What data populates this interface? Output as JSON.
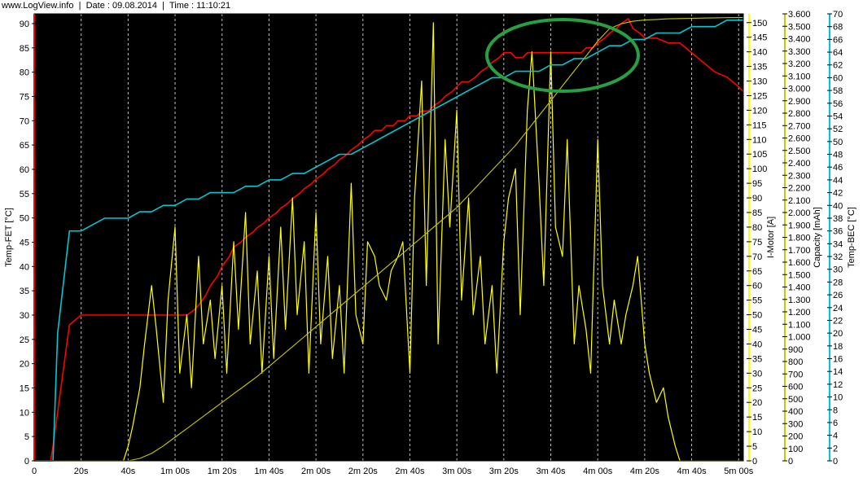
{
  "header": {
    "site": "www.LogView.info",
    "sep": "|",
    "date_label": "Date : 09.08.2014",
    "time_label": "Time : 11:10:21"
  },
  "colors": {
    "plot_bg": "#000000",
    "temp_fet": "#ff0000",
    "i_motor": "#ffff00",
    "capacity": "#c8c800",
    "temp_bec": "#00c8d2",
    "highlight_ellipse": "#28a040"
  },
  "chart_data": {
    "type": "line",
    "x_ticks": [
      "0",
      "20s",
      "40s",
      "1m 00s",
      "1m 20s",
      "1m 40s",
      "2m 00s",
      "2m 20s",
      "2m 40s",
      "3m 00s",
      "3m 20s",
      "3m 40s",
      "4m 00s",
      "4m 20s",
      "4m 40s",
      "5m 00s"
    ],
    "xlim_s": [
      0,
      302
    ],
    "grid": "vertical dashed at each x tick",
    "axes": {
      "temp_fet": {
        "label": "Temp-FET [°C]",
        "ylim": [
          0,
          92
        ],
        "ticks": [
          0,
          5,
          10,
          15,
          20,
          25,
          30,
          35,
          40,
          45,
          50,
          55,
          60,
          65,
          70,
          75,
          80,
          85,
          90
        ]
      },
      "i_motor": {
        "label": "I-Motor [A]",
        "ylim": [
          0,
          153
        ],
        "ticks": [
          0,
          5,
          10,
          15,
          20,
          25,
          30,
          35,
          40,
          45,
          50,
          55,
          60,
          65,
          70,
          75,
          80,
          85,
          90,
          95,
          100,
          105,
          110,
          115,
          120,
          125,
          130,
          135,
          140,
          145,
          150
        ]
      },
      "capacity": {
        "label": "Capacity [mAh]",
        "ylim": [
          0,
          3600
        ],
        "ticks": [
          "0",
          "100",
          "200",
          "300",
          "400",
          "500",
          "600",
          "700",
          "800",
          "900",
          "1.000",
          "1.100",
          "1.200",
          "1.300",
          "1.400",
          "1.500",
          "1.600",
          "1.700",
          "1.800",
          "1.900",
          "2.000",
          "2.100",
          "2.200",
          "2.300",
          "2.400",
          "2.500",
          "2.600",
          "2.700",
          "2.800",
          "2.900",
          "3.000",
          "3.100",
          "3.200",
          "3.300",
          "3.400",
          "3.500",
          "3.600"
        ]
      },
      "temp_bec": {
        "label": "Temp-BEC [°C]",
        "ylim": [
          0,
          70
        ],
        "ticks": [
          0,
          2,
          4,
          6,
          8,
          10,
          12,
          14,
          16,
          18,
          20,
          22,
          24,
          26,
          28,
          30,
          32,
          34,
          36,
          38,
          40,
          42,
          44,
          46,
          48,
          50,
          52,
          54,
          56,
          58,
          60,
          62,
          64,
          66,
          68,
          70
        ]
      }
    },
    "series": [
      {
        "axis": "temp_fet",
        "key": "temp_fet",
        "x": [
          0,
          7,
          8,
          15,
          20,
          30,
          35,
          40,
          45,
          48,
          50,
          53,
          55,
          58,
          60,
          63,
          65,
          68,
          70,
          73,
          75,
          78,
          80,
          83,
          85,
          88,
          90,
          93,
          95,
          98,
          100,
          103,
          105,
          108,
          110,
          113,
          115,
          118,
          120,
          123,
          125,
          128,
          130,
          133,
          135,
          138,
          140,
          143,
          145,
          148,
          150,
          153,
          155,
          158,
          160,
          163,
          165,
          168,
          170,
          173,
          175,
          178,
          180,
          182,
          185,
          188,
          190,
          193,
          195,
          198,
          200,
          203,
          205,
          208,
          210,
          213,
          215,
          218,
          220,
          223,
          225,
          228,
          230,
          233,
          235,
          238,
          240,
          243,
          245,
          248,
          250,
          253,
          255,
          258,
          260,
          265,
          270,
          275,
          280,
          285,
          290,
          295,
          300,
          302
        ],
        "y": [
          0,
          0,
          3,
          28,
          30,
          30,
          30,
          30,
          30,
          30,
          30,
          30,
          30,
          30,
          30,
          30,
          30,
          31,
          32,
          34,
          36,
          38,
          40,
          42,
          44,
          45,
          46,
          47,
          48,
          49,
          50,
          51,
          52,
          53,
          54,
          55,
          56,
          57,
          58,
          59,
          60,
          61,
          62,
          63,
          64,
          65,
          66,
          67,
          68,
          68,
          69,
          69,
          70,
          70,
          71,
          71,
          72,
          72,
          73,
          74,
          75,
          76,
          77,
          78,
          78,
          79,
          80,
          81,
          82,
          83,
          84,
          84,
          83,
          83,
          84,
          84,
          84,
          84,
          84,
          84,
          84,
          84,
          84,
          84,
          85,
          85,
          86,
          87,
          88,
          89,
          90,
          91,
          89,
          88,
          87,
          87,
          86,
          86,
          84,
          82,
          80,
          79,
          77,
          76
        ]
      },
      {
        "axis": "i_motor",
        "key": "i_motor",
        "x": [
          0,
          38,
          40,
          42,
          45,
          47,
          50,
          52,
          55,
          57,
          60,
          62,
          65,
          67,
          70,
          72,
          75,
          77,
          80,
          82,
          85,
          87,
          90,
          92,
          95,
          97,
          100,
          102,
          105,
          107,
          110,
          112,
          115,
          117,
          120,
          122,
          125,
          127,
          130,
          132,
          135,
          137,
          140,
          142,
          145,
          147,
          150,
          152,
          155,
          157,
          160,
          162,
          165,
          167,
          170,
          172,
          175,
          177,
          180,
          182,
          185,
          187,
          190,
          192,
          195,
          197,
          200,
          202,
          205,
          207,
          210,
          212,
          215,
          217,
          220,
          222,
          225,
          227,
          230,
          232,
          235,
          237,
          240,
          242,
          245,
          247,
          250,
          252,
          255,
          257,
          260,
          262,
          265,
          268,
          270,
          273,
          275,
          278,
          280,
          302
        ],
        "y": [
          0,
          0,
          5,
          12,
          25,
          40,
          60,
          45,
          20,
          55,
          80,
          30,
          50,
          25,
          70,
          40,
          55,
          35,
          60,
          30,
          75,
          45,
          85,
          40,
          65,
          30,
          70,
          35,
          80,
          45,
          90,
          50,
          75,
          30,
          85,
          40,
          70,
          35,
          60,
          30,
          95,
          50,
          40,
          75,
          70,
          60,
          55,
          65,
          70,
          75,
          30,
          90,
          130,
          60,
          150,
          40,
          110,
          80,
          120,
          55,
          90,
          50,
          70,
          40,
          60,
          30,
          75,
          90,
          100,
          50,
          120,
          140,
          95,
          60,
          140,
          80,
          70,
          110,
          40,
          60,
          45,
          30,
          110,
          60,
          40,
          55,
          40,
          50,
          60,
          70,
          40,
          30,
          20,
          25,
          15,
          5,
          0,
          0,
          0,
          0
        ]
      },
      {
        "axis": "capacity",
        "key": "capacity",
        "x": [
          0,
          40,
          45,
          50,
          55,
          60,
          65,
          70,
          75,
          80,
          85,
          90,
          95,
          100,
          105,
          110,
          115,
          120,
          125,
          130,
          135,
          140,
          145,
          150,
          155,
          160,
          165,
          170,
          175,
          180,
          185,
          190,
          195,
          200,
          205,
          210,
          215,
          220,
          225,
          230,
          235,
          240,
          245,
          250,
          255,
          260,
          265,
          270,
          275,
          280,
          285,
          290,
          295,
          300,
          302
        ],
        "y": [
          0,
          0,
          20,
          60,
          120,
          190,
          260,
          330,
          400,
          470,
          540,
          610,
          680,
          760,
          840,
          920,
          1000,
          1080,
          1160,
          1240,
          1320,
          1400,
          1480,
          1560,
          1640,
          1720,
          1800,
          1880,
          1960,
          2040,
          2140,
          2240,
          2340,
          2440,
          2540,
          2660,
          2780,
          2900,
          3020,
          3140,
          3260,
          3380,
          3480,
          3520,
          3540,
          3550,
          3555,
          3560,
          3562,
          3564,
          3566,
          3568,
          3569,
          3570,
          3570
        ]
      },
      {
        "axis": "temp_bec",
        "key": "temp_bec",
        "x": [
          0,
          8,
          10,
          15,
          20,
          25,
          30,
          35,
          40,
          45,
          50,
          55,
          60,
          65,
          70,
          75,
          80,
          85,
          90,
          95,
          100,
          105,
          110,
          115,
          120,
          125,
          130,
          135,
          140,
          145,
          150,
          155,
          160,
          165,
          170,
          175,
          180,
          185,
          190,
          195,
          200,
          205,
          210,
          215,
          220,
          225,
          230,
          235,
          240,
          245,
          250,
          255,
          260,
          265,
          270,
          275,
          280,
          285,
          290,
          295,
          300,
          302
        ],
        "y": [
          0,
          0,
          20,
          36,
          36,
          37,
          38,
          38,
          38,
          39,
          39,
          40,
          40,
          41,
          41,
          42,
          42,
          42,
          43,
          43,
          44,
          44,
          45,
          45,
          46,
          47,
          48,
          48,
          49,
          50,
          51,
          52,
          53,
          54,
          55,
          56,
          57,
          58,
          59,
          60,
          60,
          61,
          61,
          61,
          62,
          62,
          63,
          63,
          64,
          65,
          65,
          66,
          66,
          67,
          67,
          67,
          68,
          68,
          68,
          69,
          69,
          69
        ]
      }
    ]
  }
}
